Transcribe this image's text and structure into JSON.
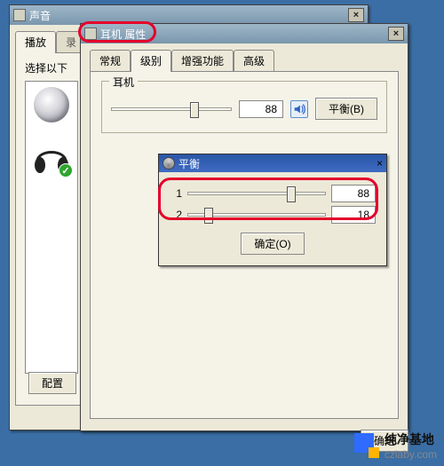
{
  "sound_window": {
    "title": "声音",
    "close": "×",
    "tabs": {
      "play": "播放",
      "record": "录"
    },
    "hint": "选择以下",
    "config_btn": "配置"
  },
  "props_window": {
    "title": "耳机 属性",
    "close": "×",
    "tabs": {
      "general": "常规",
      "levels": "级别",
      "enhance": "增强功能",
      "advanced": "高级"
    },
    "group_label": "耳机",
    "master_value": "88",
    "balance_btn": "平衡(B)"
  },
  "balance_window": {
    "title": "平衡",
    "close": "×",
    "rows": [
      {
        "label": "1",
        "value": "88",
        "pos": 0.72
      },
      {
        "label": "2",
        "value": "18",
        "pos": 0.12
      }
    ],
    "ok": "确定(O)"
  },
  "footer": {
    "ok": "确定"
  },
  "watermark": {
    "name": "纯净基地",
    "url": "czlaby.com"
  }
}
